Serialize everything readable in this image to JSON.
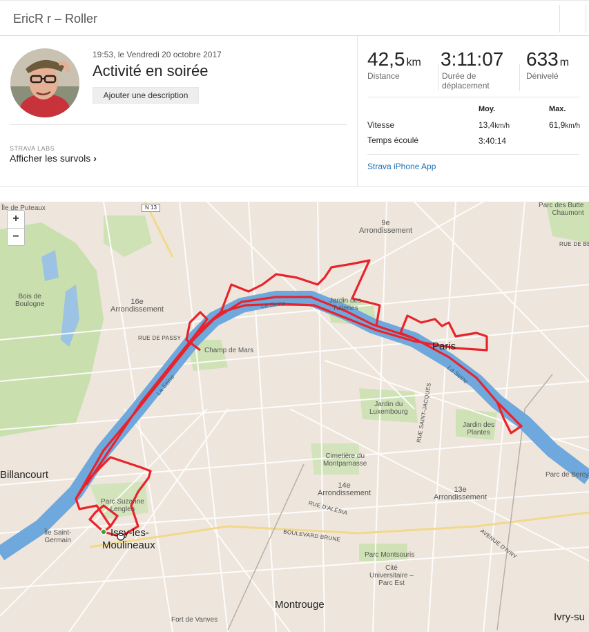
{
  "header": {
    "title": "EricR r – Roller"
  },
  "activity": {
    "datetime": "19:53, le Vendredi 20 octobre 2017",
    "name": "Activité en soirée",
    "add_description": "Ajouter une description"
  },
  "labs": {
    "tag": "STRAVA LABS",
    "flyby": "Afficher les survols",
    "chevron": "›"
  },
  "stats": {
    "distance": {
      "value": "42,5",
      "unit": "km",
      "label": "Distance"
    },
    "moving_time": {
      "value": "3:11:07",
      "label_line1": "Durée de",
      "label_line2": "déplacement"
    },
    "elevation": {
      "value": "633",
      "unit": "m",
      "label": "Dénivelé"
    },
    "col_avg": "Moy.",
    "col_max": "Max.",
    "speed": {
      "label": "Vitesse",
      "avg": "13,4",
      "max": "61,9",
      "unit": "km/h"
    },
    "elapsed": {
      "label": "Temps écoulé",
      "value": "3:40:14"
    },
    "app_link": "Strava iPhone App"
  },
  "map": {
    "zoom_in": "+",
    "zoom_out": "−",
    "road_shield": "N 13",
    "labels": {
      "puteaux": "Île de Puteaux",
      "arr9": "9e\nArrondissement",
      "butte": "Parc des Butte\nChaumont",
      "bois": "Bois de\nBoulogne",
      "arr16": "16e\nArrondissement",
      "tuileries": "Jardin des\nTuileries",
      "passy": "RUE DE PASSY",
      "champ": "Champ de Mars",
      "paris": "Paris",
      "seine1": "La Seine",
      "seine2": "La Seine",
      "seine3": "La Seine",
      "luxembourg": "Jardin du\nLuxembourg",
      "stjacques": "RUE SAINT-JACQUES",
      "plantes": "Jardin des\nPlantes",
      "billancourt": "Billancourt",
      "cimetiere": "Cimetière du\nMontparnasse",
      "bercy": "Parc de Bercy",
      "arr14": "14e\nArrondissement",
      "arr13": "13e\nArrondissement",
      "suzanne": "Parc Suzanne\nLenglen",
      "alesia": "RUE D'ALÉSIA",
      "stgermain": "Île Saint-\nGermain",
      "issy1": "Issy-les-",
      "issy2": "Moulineaux",
      "brune": "BOULEVARD BRUNE",
      "ivry_av": "AVENUE D'IVRY",
      "montsouris": "Parc Montsouris",
      "cite": "Cité\nUniversitaire –\nParc Est",
      "montrouge": "Montrouge",
      "vanves": "Fort de Vanves",
      "ivry": "Ivry-su",
      "belleville": "RUE DE BE"
    }
  }
}
